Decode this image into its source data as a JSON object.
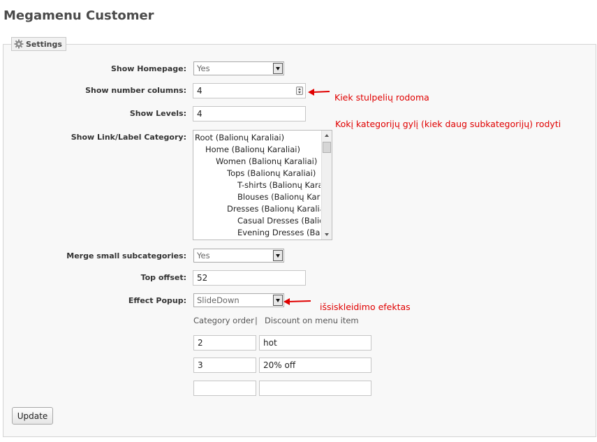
{
  "page": {
    "title": "Megamenu Customer"
  },
  "legend": {
    "label": "Settings",
    "icon": "gear-icon"
  },
  "fields": {
    "show_homepage": {
      "label": "Show Homepage:",
      "value": "Yes"
    },
    "show_number_columns": {
      "label": "Show number columns:",
      "value": "4"
    },
    "show_levels": {
      "label": "Show Levels:",
      "value": "4"
    },
    "show_link_label_category": {
      "label": "Show Link/Label Category:",
      "options": [
        "Root (Balionų Karaliai)",
        "Home (Balionų Karaliai)",
        "Women (Balionų Karaliai)",
        "Tops (Balionų Karaliai)",
        "T-shirts (Balionų Kara",
        "Blouses (Balionų Kara",
        "Dresses (Balionų Karalia",
        "Casual Dresses (Balio",
        "Evening Dresses (Bali"
      ]
    },
    "merge_small_subcategories": {
      "label": "Merge small subcategories:",
      "value": "Yes"
    },
    "top_offset": {
      "label": "Top offset:",
      "value": "52"
    },
    "effect_popup": {
      "label": "Effect Popup:",
      "value": "SlideDown"
    }
  },
  "discount_table": {
    "header_category_order": "Category order",
    "header_separator": "|",
    "header_discount": "Discount on menu item",
    "rows": [
      {
        "order": "2",
        "discount": "hot"
      },
      {
        "order": "3",
        "discount": "20% off"
      },
      {
        "order": "",
        "discount": ""
      }
    ]
  },
  "annotations": {
    "columns_note": "Kiek stulpelių rodoma",
    "levels_note": "Kokį kategorijų gylį (kiek daug subkategorijų) rodyti",
    "effect_note": "išsiskleidimo efektas",
    "arrow_color": "#e00000"
  },
  "actions": {
    "update_label": "Update"
  }
}
